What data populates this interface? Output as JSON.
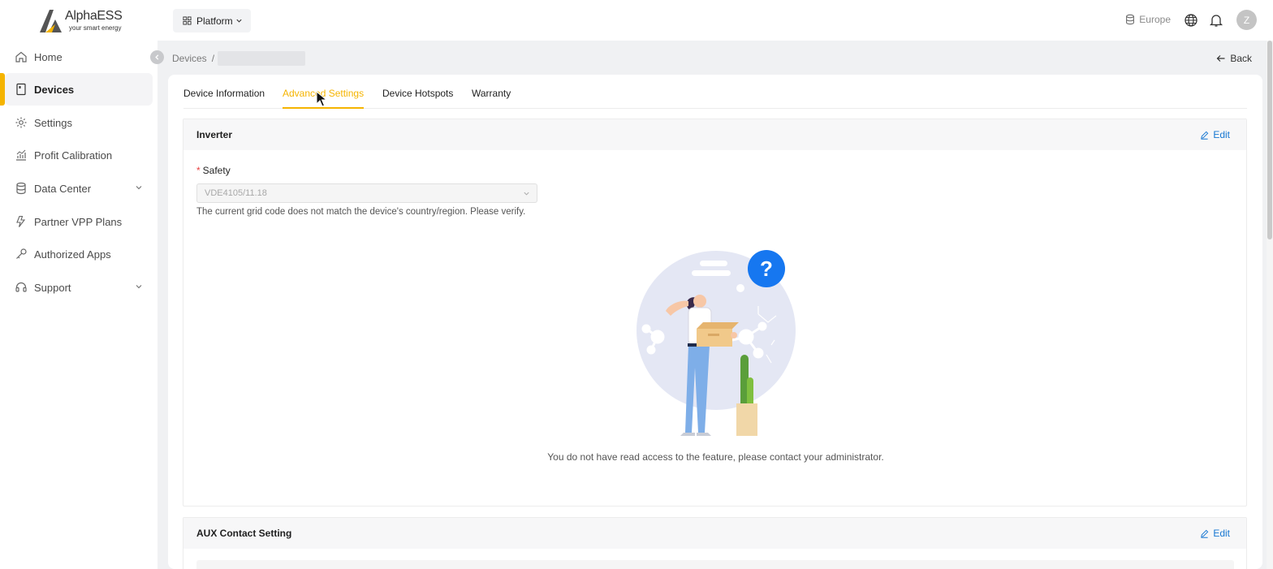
{
  "app": {
    "brand": "AlphaESS",
    "tagline": "your smart energy"
  },
  "sidebar": {
    "items": [
      {
        "label": "Home",
        "icon": "home-icon"
      },
      {
        "label": "Devices",
        "icon": "device-icon",
        "active": true
      },
      {
        "label": "Settings",
        "icon": "gear-icon"
      },
      {
        "label": "Profit Calibration",
        "icon": "chart-icon"
      },
      {
        "label": "Data Center",
        "icon": "database-icon",
        "has_children": true
      },
      {
        "label": "Partner VPP Plans",
        "icon": "lightning-icon"
      },
      {
        "label": "Authorized Apps",
        "icon": "key-icon"
      },
      {
        "label": "Support",
        "icon": "headset-icon",
        "has_children": true
      }
    ]
  },
  "topbar": {
    "platform_label": "Platform",
    "region": "Europe",
    "avatar_letter": "Z"
  },
  "breadcrumb": {
    "root": "Devices",
    "separator": "/"
  },
  "back_label": "Back",
  "tabs": [
    {
      "label": "Device Information"
    },
    {
      "label": "Advanced Settings",
      "active": true
    },
    {
      "label": "Device Hotspots"
    },
    {
      "label": "Warranty"
    }
  ],
  "inverter": {
    "title": "Inverter",
    "edit_label": "Edit",
    "safety_label": "Safety",
    "required_mark": "*",
    "safety_value": "VDE4105/11.18",
    "hint": "The current grid code does not match the device's country/region. Please verify.",
    "empty_message": "You do not have read access to the feature, please contact your administrator.",
    "illus_badge": "?"
  },
  "aux": {
    "title": "AUX Contact Setting",
    "edit_label": "Edit"
  },
  "colors": {
    "accent": "#f5b400",
    "link": "#1677d2",
    "help_badge": "#1677f0"
  }
}
